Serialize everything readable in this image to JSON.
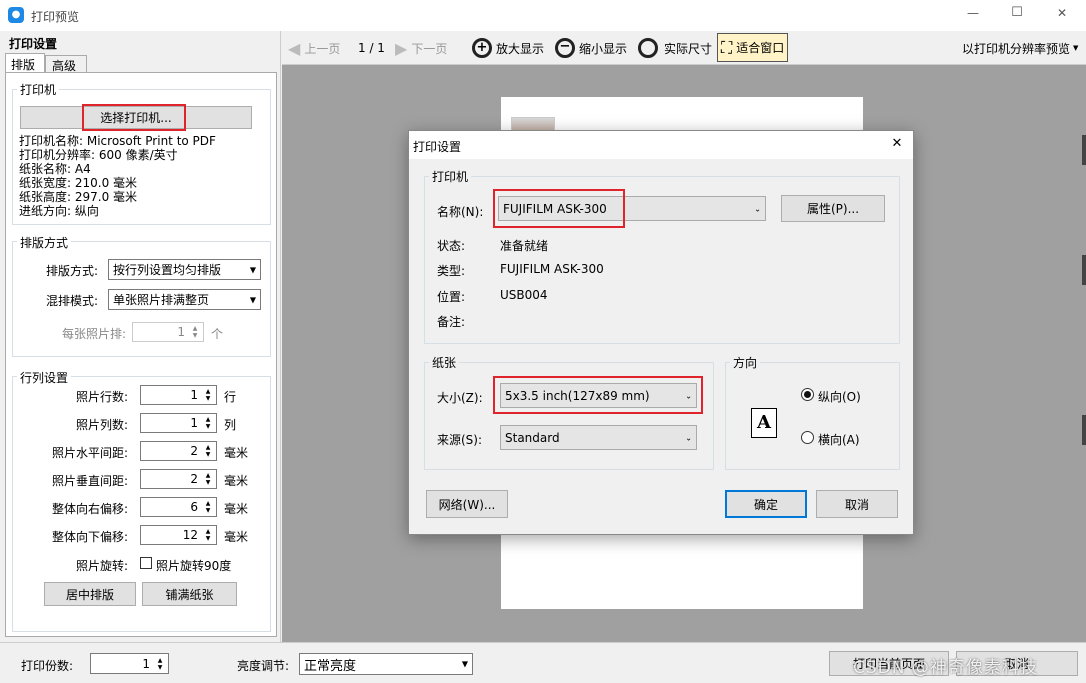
{
  "window": {
    "title": "打印预览",
    "min": "—",
    "max": "☐",
    "close": "✕"
  },
  "left": {
    "title": "打印设置",
    "tabs": [
      "排版",
      "高级"
    ],
    "printer": {
      "group": "打印机",
      "select_btn": "选择打印机...",
      "info": [
        "打印机名称: Microsoft Print to PDF",
        "打印机分辨率: 600 像素/英寸",
        "纸张名称: A4",
        "纸张宽度: 210.0 毫米",
        "纸张高度: 297.0 毫米",
        "进纸方向: 纵向"
      ]
    },
    "layout": {
      "group": "排版方式",
      "mode_label": "排版方式:",
      "mode_value": "按行列设置均匀排版",
      "mix_label": "混排模式:",
      "mix_value": "单张照片排满整页",
      "per_label": "每张照片排:",
      "per_value": "1",
      "per_unit": "个"
    },
    "grid": {
      "group": "行列设置",
      "rows": [
        {
          "label": "照片行数:",
          "value": "1",
          "unit": "行"
        },
        {
          "label": "照片列数:",
          "value": "1",
          "unit": "列"
        },
        {
          "label": "照片水平间距:",
          "value": "2",
          "unit": "毫米"
        },
        {
          "label": "照片垂直间距:",
          "value": "2",
          "unit": "毫米"
        },
        {
          "label": "整体向右偏移:",
          "value": "6",
          "unit": "毫米"
        },
        {
          "label": "整体向下偏移:",
          "value": "12",
          "unit": "毫米"
        }
      ],
      "rotate_label": "照片旋转:",
      "rotate_check": "照片旋转90度",
      "center_btn": "居中排版",
      "fill_btn": "铺满纸张"
    }
  },
  "toolbar": {
    "prev": "上一页",
    "page": "1 / 1",
    "next": "下一页",
    "zoom_in": "放大显示",
    "zoom_out": "缩小显示",
    "actual": "实际尺寸",
    "fit": "适合窗口",
    "res_preview": "以打印机分辨率预览"
  },
  "bottom": {
    "copies_label": "打印份数:",
    "copies_value": "1",
    "bright_label": "亮度调节:",
    "bright_value": "正常亮度",
    "print_btn": "打印当前页面",
    "cancel_btn": "取消",
    "watermark": "CSDN @神奇像素科技"
  },
  "dialog": {
    "title": "打印设置",
    "close": "✕",
    "printer_group": "打印机",
    "name_label": "名称(N):",
    "name_value": "FUJIFILM ASK-300",
    "props_btn": "属性(P)...",
    "status_label": "状态:",
    "status_value": "准备就绪",
    "type_label": "类型:",
    "type_value": "FUJIFILM ASK-300",
    "where_label": "位置:",
    "where_value": "USB004",
    "comment_label": "备注:",
    "paper_group": "纸张",
    "size_label": "大小(Z):",
    "size_value": "5x3.5 inch(127x89 mm)",
    "source_label": "来源(S):",
    "source_value": "Standard",
    "orient_group": "方向",
    "portrait": "纵向(O)",
    "landscape": "横向(A)",
    "orient_glyph": "A",
    "network_btn": "网络(W)...",
    "ok_btn": "确定",
    "cancel_btn": "取消"
  }
}
